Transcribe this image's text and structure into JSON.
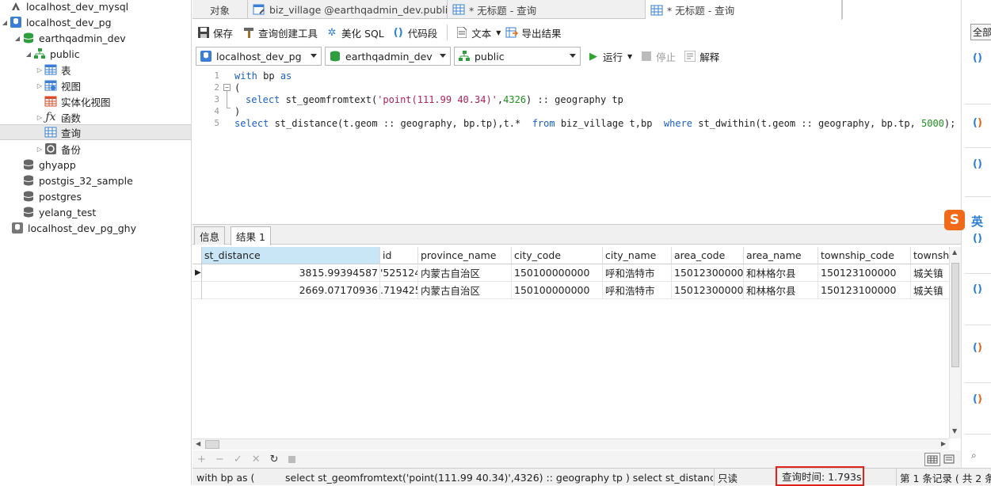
{
  "sidebar": {
    "items": [
      {
        "label": "localhost_dev_mysql",
        "icon": "mysql-connection-icon"
      },
      {
        "label": "localhost_dev_pg",
        "icon": "postgres-connection-icon"
      },
      {
        "label": "earthqadmin_dev",
        "icon": "database-icon"
      },
      {
        "label": "public",
        "icon": "schema-icon"
      },
      {
        "label": "表",
        "icon": "table-icon"
      },
      {
        "label": "视图",
        "icon": "view-icon"
      },
      {
        "label": "实体化视图",
        "icon": "materialized-view-icon"
      },
      {
        "label": "函数",
        "icon": "function-icon"
      },
      {
        "label": "查询",
        "icon": "query-icon"
      },
      {
        "label": "备份",
        "icon": "backup-icon"
      },
      {
        "label": "ghyapp",
        "icon": "database-icon"
      },
      {
        "label": "postgis_32_sample",
        "icon": "database-icon"
      },
      {
        "label": "postgres",
        "icon": "database-icon"
      },
      {
        "label": "yelang_test",
        "icon": "database-icon"
      },
      {
        "label": "localhost_dev_pg_ghy",
        "icon": "postgres-connection-icon"
      }
    ]
  },
  "tabs": [
    {
      "label": "对象"
    },
    {
      "label": "biz_village @earthqadmin_dev.public..."
    },
    {
      "label": "* 无标题 - 查询"
    },
    {
      "label": "* 无标题 - 查询"
    }
  ],
  "toolbar": {
    "save": "保存",
    "query_builder": "查询创建工具",
    "beautify": "美化 SQL",
    "snippet": "代码段",
    "text": "文本",
    "export": "导出结果"
  },
  "selectors": {
    "connection": "localhost_dev_pg",
    "database": "earthqadmin_dev",
    "schema": "public",
    "run": "运行",
    "stop": "停止",
    "explain": "解释"
  },
  "editor": {
    "line_numbers": [
      "1",
      "2",
      "3",
      "4",
      "5"
    ],
    "lines": {
      "l1_kw1": "with",
      "l1_rest": " bp ",
      "l1_kw2": "as",
      "l2": "(",
      "l3_kw": "select",
      "l3_fn": " st_geomfromtext(",
      "l3_str": "'point(111.99 40.34)'",
      "l3_comma": ",",
      "l3_num": "4326",
      "l3_rest": ") :: geography tp",
      "l4": ")",
      "l5_kw1": "select",
      "l5_a": " st_distance(t.geom :: geography, bp.tp),t.*  ",
      "l5_kw2": "from",
      "l5_b": " biz_village t,bp  ",
      "l5_kw3": "where",
      "l5_c": " st_dwithin(t.geom :: geography, bp.tp, ",
      "l5_num": "5000",
      "l5_end": ");"
    }
  },
  "result_tabs": [
    {
      "label": "信息"
    },
    {
      "label": "结果 1"
    }
  ],
  "grid": {
    "columns": [
      "st_distance",
      "id",
      "province_name",
      "city_code",
      "city_name",
      "area_code",
      "area_name",
      "township_code",
      "townsh"
    ],
    "rows": [
      [
        "3815.99394587",
        "'525124",
        "内蒙古自治区",
        "150100000000",
        "呼和浩特市",
        "150123000000",
        "和林格尔县",
        "150123100000",
        "城关镇"
      ],
      [
        "2669.07170936",
        ".719425",
        "内蒙古自治区",
        "150100000000",
        "呼和浩特市",
        "150123000000",
        "和林格尔县",
        "150123100000",
        "城关镇"
      ]
    ]
  },
  "right_strip": {
    "button": "全部",
    "ime": "英"
  },
  "status": {
    "sql_preview_1": "with bp as  (",
    "sql_preview_2": "select st_geomfromtext('point(111.99 40.34)',4326) :: geography tp ) select st_distance(t.geon",
    "readonly": "只读",
    "query_time": "查询时间: 1.793s",
    "records": "第 1 条记录 ( 共 2 条"
  },
  "colors": {
    "keyword": "#1a5fc9",
    "string": "#b0205a",
    "number": "#1f8f1f",
    "highlight_box": "#e0241b",
    "selected_header": "#c9e6f7"
  }
}
